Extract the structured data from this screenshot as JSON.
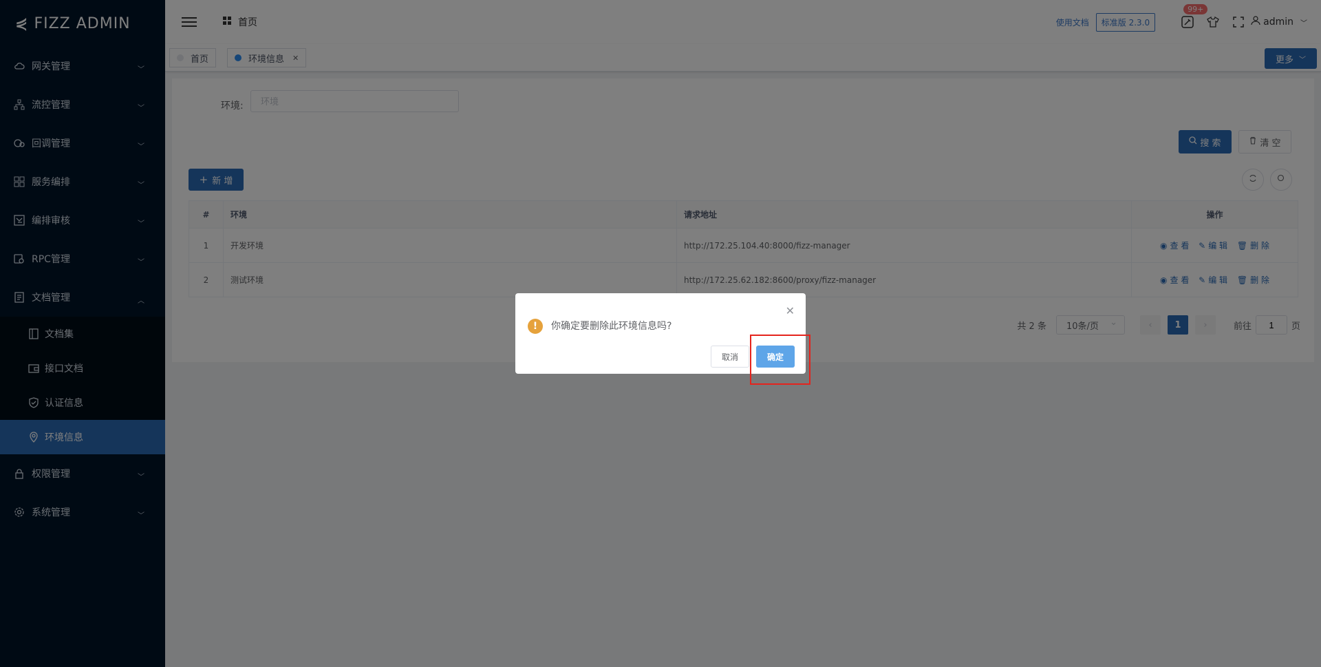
{
  "logo": {
    "text": "FIZZ ADMIN"
  },
  "sidebar": {
    "items": [
      {
        "label": "网关管理",
        "icon": "cloud-icon"
      },
      {
        "label": "流控管理",
        "icon": "sitemap-icon"
      },
      {
        "label": "回调管理",
        "icon": "callback-icon"
      },
      {
        "label": "服务编排",
        "icon": "grid-icon"
      },
      {
        "label": "编排审核",
        "icon": "audit-icon"
      },
      {
        "label": "RPC管理",
        "icon": "rpc-icon"
      },
      {
        "label": "文档管理",
        "icon": "document-icon"
      }
    ],
    "sub_items": [
      {
        "label": "文档集",
        "icon": "book-icon"
      },
      {
        "label": "接口文档",
        "icon": "wallet-icon"
      },
      {
        "label": "认证信息",
        "icon": "shield-icon"
      },
      {
        "label": "环境信息",
        "icon": "location-icon",
        "active": true
      }
    ],
    "items_after": [
      {
        "label": "权限管理",
        "icon": "lock-icon"
      },
      {
        "label": "系统管理",
        "icon": "settings-icon"
      }
    ]
  },
  "header": {
    "breadcrumb": "首页",
    "doc_link": "使用文档",
    "version": "标准版 2.3.0",
    "badge": "99+",
    "user": "admin"
  },
  "tags": {
    "items": [
      {
        "label": "首页"
      },
      {
        "label": "环境信息",
        "active": true
      }
    ],
    "more_label": "更多"
  },
  "search": {
    "label": "环境:",
    "placeholder": "环境",
    "search_label": "搜 索",
    "clear_label": "清 空"
  },
  "toolbar": {
    "add_label": "新 增"
  },
  "table": {
    "headers": [
      "#",
      "环境",
      "请求地址",
      "操作"
    ],
    "rows": [
      {
        "idx": "1",
        "env": "开发环境",
        "url": "http://172.25.104.40:8000/fizz-manager"
      },
      {
        "idx": "2",
        "env": "测试环境",
        "url": "http://172.25.62.182:8600/proxy/fizz-manager"
      }
    ],
    "ops": {
      "view": "查 看",
      "edit": "编 辑",
      "delete": "删 除"
    }
  },
  "pagination": {
    "total": "共 2 条",
    "page_size": "10条/页",
    "current": "1",
    "goto_label": "前往",
    "goto_value": "1",
    "page_unit": "页"
  },
  "dialog": {
    "message": "你确定要删除此环境信息吗?",
    "cancel": "取消",
    "confirm": "确定"
  },
  "colors": {
    "sidebar_bg": "#001529",
    "primary": "#2b6ab5",
    "warning": "#e6a23c",
    "highlight": "#e5231c"
  }
}
